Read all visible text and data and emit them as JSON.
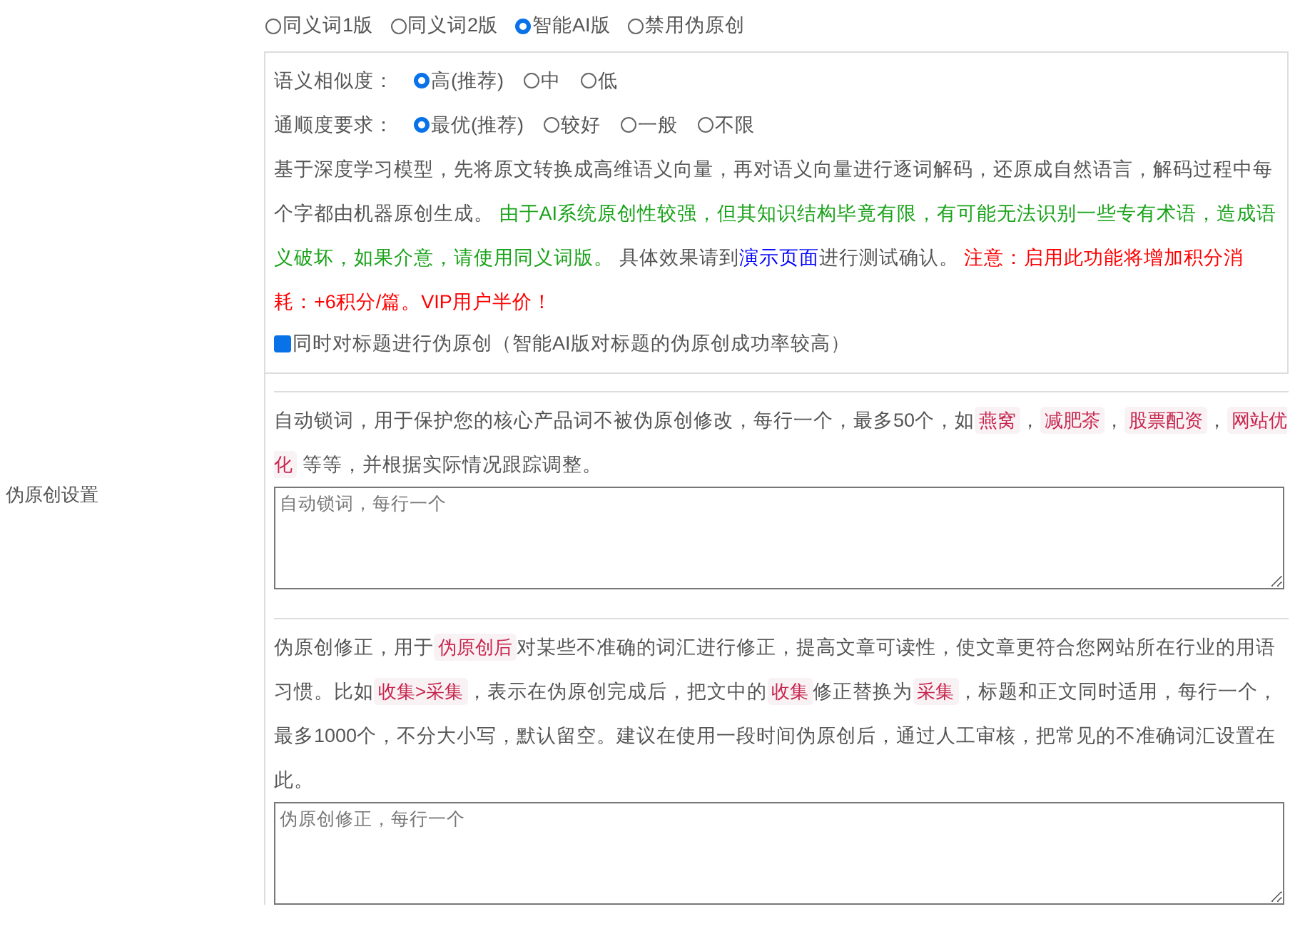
{
  "side_label": "伪原创设置",
  "modes": [
    {
      "label": "同义词1版",
      "selected": false
    },
    {
      "label": "同义词2版",
      "selected": false
    },
    {
      "label": "智能AI版",
      "selected": true
    },
    {
      "label": "禁用伪原创",
      "selected": false
    }
  ],
  "ai_panel": {
    "option_groups": [
      {
        "label": "语义相似度：",
        "options": [
          {
            "label": "高(推荐)",
            "selected": true
          },
          {
            "label": "中",
            "selected": false
          },
          {
            "label": "低",
            "selected": false
          }
        ]
      },
      {
        "label": "通顺度要求：",
        "options": [
          {
            "label": "最优(推荐)",
            "selected": true
          },
          {
            "label": "较好",
            "selected": false
          },
          {
            "label": "一般",
            "selected": false
          },
          {
            "label": "不限",
            "selected": false
          }
        ]
      }
    ],
    "description": [
      {
        "kind": "plain",
        "text": "基于深度学习模型，先将原文转换成高维语义向量，再对语义向量进行逐词解码，还原成自然语言，解码过程中每个字都由机器原创生成。 "
      },
      {
        "kind": "warning",
        "text": "由于AI系统原创性较强，但其知识结构毕竟有限，有可能无法识别一些专有术语，造成语义破坏，如果介意，请使用同义词版。"
      },
      {
        "kind": "plain",
        "text": " 具体效果请到"
      },
      {
        "kind": "link",
        "text": "演示页面"
      },
      {
        "kind": "plain",
        "text": "进行测试确认。 "
      },
      {
        "kind": "alert",
        "text": "注意：启用此功能将增加积分消耗：+6积分/篇。VIP用户半价！"
      }
    ],
    "title_option": {
      "label": "同时对标题进行伪原创（智能AI版对标题的伪原创成功率较高）",
      "checked": true
    }
  },
  "lock_words": {
    "description": [
      {
        "kind": "plain",
        "text": "自动锁词，用于保护您的核心产品词不被伪原创修改，每行一个，最多50个，如"
      },
      {
        "kind": "code",
        "text": "燕窝"
      },
      {
        "kind": "plain",
        "text": "，"
      },
      {
        "kind": "code",
        "text": "减肥茶"
      },
      {
        "kind": "plain",
        "text": "，"
      },
      {
        "kind": "code",
        "text": "股票配资"
      },
      {
        "kind": "plain",
        "text": "，"
      },
      {
        "kind": "code",
        "text": "网站优化"
      },
      {
        "kind": "plain",
        "text": " 等等，并根据实际情况跟踪调整。"
      }
    ],
    "placeholder": "自动锁词，每行一个"
  },
  "corrections": {
    "description": [
      {
        "kind": "plain",
        "text": "伪原创修正，用于"
      },
      {
        "kind": "code",
        "text": "伪原创后"
      },
      {
        "kind": "plain",
        "text": "对某些不准确的词汇进行修正，提高文章可读性，使文章更符合您网站所在行业的用语习惯。比如"
      },
      {
        "kind": "code",
        "text": "收集>采集"
      },
      {
        "kind": "plain",
        "text": "，表示在伪原创完成后，把文中的"
      },
      {
        "kind": "code",
        "text": "收集"
      },
      {
        "kind": "plain",
        "text": "修正替换为"
      },
      {
        "kind": "code",
        "text": "采集"
      },
      {
        "kind": "plain",
        "text": "，标题和正文同时适用，每行一个，最多1000个，不分大小写，默认留空。建议在使用一段时间伪原创后，通过人工审核，把常见的不准确词汇设置在此。"
      }
    ],
    "placeholder": "伪原创修正，每行一个"
  }
}
